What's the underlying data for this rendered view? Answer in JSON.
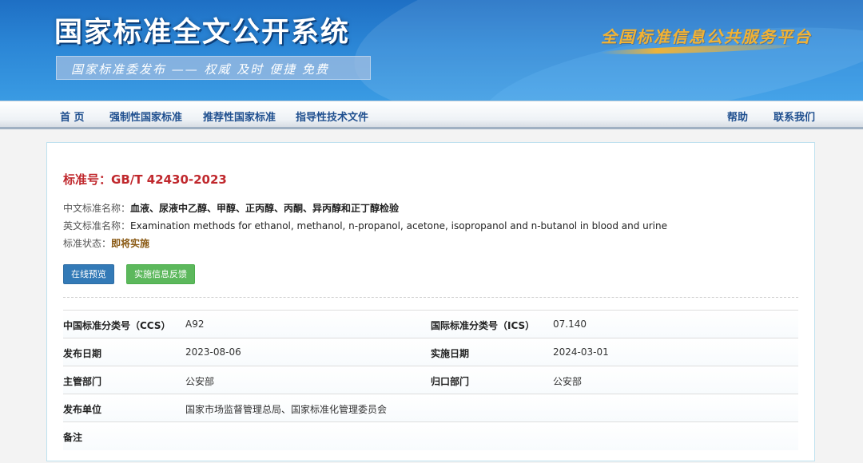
{
  "header": {
    "site_title": "国家标准全文公开系统",
    "slogan": "国家标准委发布 —— 权威 及时 便捷 免费",
    "platform_name": "全国标准信息公共服务平台"
  },
  "nav": {
    "left": [
      "首 页",
      "强制性国家标准",
      "推荐性国家标准",
      "指导性技术文件"
    ],
    "right": [
      "帮助",
      "联系我们"
    ]
  },
  "standard": {
    "number_label": "标准号：",
    "number": "GB/T 42430-2023",
    "cn_name_label": "中文标准名称：",
    "cn_name": "血液、尿液中乙醇、甲醇、正丙醇、丙酮、异丙醇和正丁醇检验",
    "en_name_label": "英文标准名称：",
    "en_name": "Examination methods for ethanol, methanol, n-propanol, acetone, isopropanol and n-butanol in blood and urine",
    "status_label": "标准状态：",
    "status": "即将实施"
  },
  "buttons": {
    "preview": "在线预览",
    "feedback": "实施信息反馈"
  },
  "details": [
    {
      "l1": "中国标准分类号（CCS）",
      "v1": "A92",
      "l2": "国际标准分类号（ICS）",
      "v2": "07.140"
    },
    {
      "l1": "发布日期",
      "v1": "2023-08-06",
      "l2": "实施日期",
      "v2": "2024-03-01"
    },
    {
      "l1": "主管部门",
      "v1": "公安部",
      "l2": "归口部门",
      "v2": "公安部"
    },
    {
      "l1": "发布单位",
      "v1": "国家市场监督管理总局、国家标准化管理委员会",
      "l2": "",
      "v2": ""
    },
    {
      "l1": "备注",
      "v1": "",
      "l2": "",
      "v2": ""
    }
  ],
  "colors": {
    "title_red": "#c0282d",
    "status_brown": "#8a5a14",
    "nav_blue": "#1f4f8f",
    "btn_blue": "#337ab7",
    "btn_green": "#5cb85c"
  }
}
